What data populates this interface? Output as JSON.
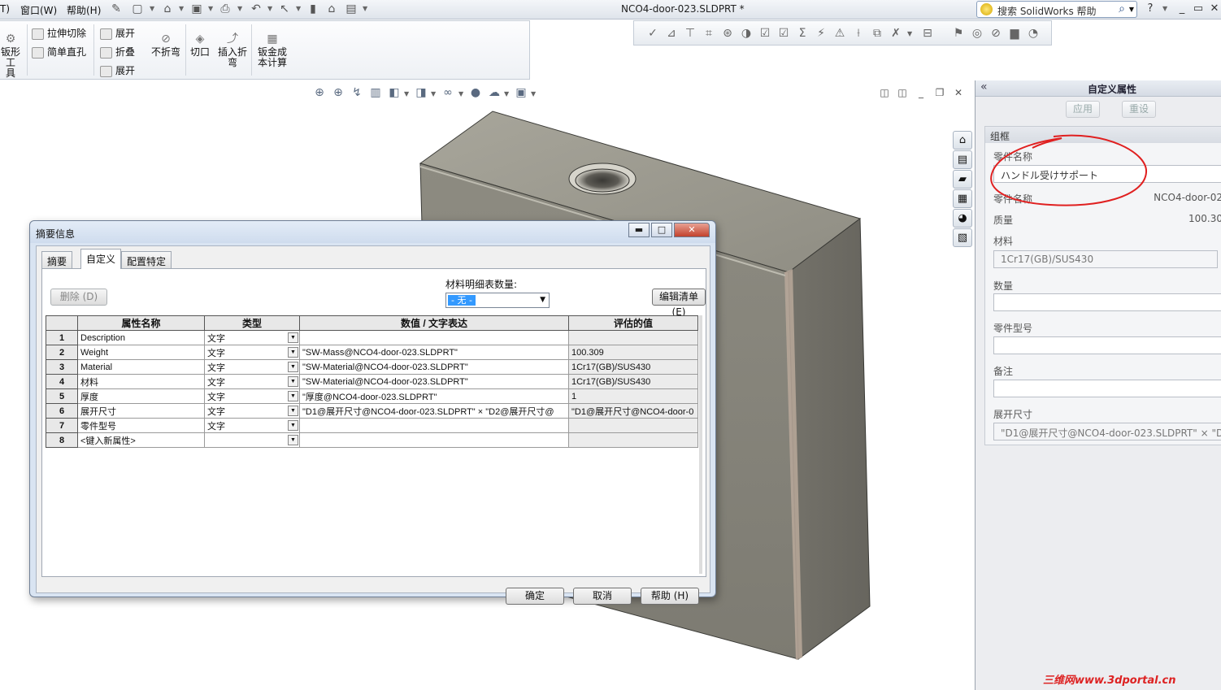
{
  "menu": {
    "items": [
      {
        "label": "T)"
      },
      {
        "label": "窗口(W)"
      },
      {
        "label": "帮助(H)"
      }
    ]
  },
  "window": {
    "title": "NCO4-door-023.SLDPRT *",
    "search_placeholder": "搜索 SolidWorks 帮助"
  },
  "command_manager": {
    "partial_tool_line1": "钣形工",
    "partial_tool_line2": "具",
    "extruded_cut": "拉伸切除",
    "simple_hole": "简单直孔",
    "unfold": "展开",
    "fold": "折叠",
    "flatten": "展开",
    "no_bends": "不折弯",
    "rip": "切口",
    "insert_bends_line1": "插入折",
    "insert_bends_line2": "弯",
    "sheetmetal_cost_line1": "钣金成",
    "sheetmetal_cost_line2": "本计算"
  },
  "task_pane": {
    "title": "自定义属性",
    "apply": "应用",
    "reset": "重设",
    "group_title": "组框",
    "fields": {
      "part_name_label": "零件名称",
      "part_name_value": "ハンドル受けサポート",
      "part_name2_label": "零件名称",
      "part_name2_value": "NCO4-door-02",
      "mass_label": "质量",
      "mass_value": "100.30",
      "material_label": "材料",
      "material_value": "1Cr17(GB)/SUS430",
      "qty_label": "数量",
      "qty_value": "",
      "part_model_label": "零件型号",
      "part_model_value": "",
      "remark_label": "备注",
      "remark_value": "",
      "flat_size_label": "展开尺寸",
      "flat_size_value": "\"D1@展开尺寸@NCO4-door-023.SLDPRT\" × \"D2"
    }
  },
  "dialog": {
    "title": "摘要信息",
    "tabs": [
      "摘要",
      "自定义",
      "配置特定"
    ],
    "active_tab": "自定义",
    "delete_button": "删除 (D)",
    "bom_qty_label": "材料明细表数量:",
    "bom_qty_value": "- 无 -",
    "edit_list_button": "编辑清单 (E)",
    "columns": [
      "",
      "属性名称",
      "类型",
      "数值 / 文字表达",
      "评估的值"
    ],
    "rows": [
      {
        "n": "1",
        "name": "Description",
        "type": "文字",
        "value": "",
        "evaluated": ""
      },
      {
        "n": "2",
        "name": "Weight",
        "type": "文字",
        "value": "\"SW-Mass@NCO4-door-023.SLDPRT\"",
        "evaluated": "100.309"
      },
      {
        "n": "3",
        "name": "Material",
        "type": "文字",
        "value": "\"SW-Material@NCO4-door-023.SLDPRT\"",
        "evaluated": "1Cr17(GB)/SUS430"
      },
      {
        "n": "4",
        "name": "材料",
        "type": "文字",
        "value": "\"SW-Material@NCO4-door-023.SLDPRT\"",
        "evaluated": "1Cr17(GB)/SUS430"
      },
      {
        "n": "5",
        "name": "厚度",
        "type": "文字",
        "value": "\"厚度@NCO4-door-023.SLDPRT\"",
        "evaluated": "1"
      },
      {
        "n": "6",
        "name": "展开尺寸",
        "type": "文字",
        "value": "\"D1@展开尺寸@NCO4-door-023.SLDPRT\" × \"D2@展开尺寸@",
        "evaluated": "\"D1@展开尺寸@NCO4-door-0"
      },
      {
        "n": "7",
        "name": "零件型号",
        "type": "文字",
        "value": "",
        "evaluated": ""
      },
      {
        "n": "8",
        "name": "<键入新属性>",
        "type": "",
        "value": "",
        "evaluated": ""
      }
    ],
    "ok_button": "确定",
    "cancel_button": "取消",
    "help_button": "帮助 (H)"
  },
  "watermark": "三维网www.3dportal.cn",
  "colors": {
    "annotation_circle": "#e02020",
    "part_face_front": "#8c8a80",
    "part_face_side": "#6f6d65",
    "part_face_top": "#a5a398"
  }
}
